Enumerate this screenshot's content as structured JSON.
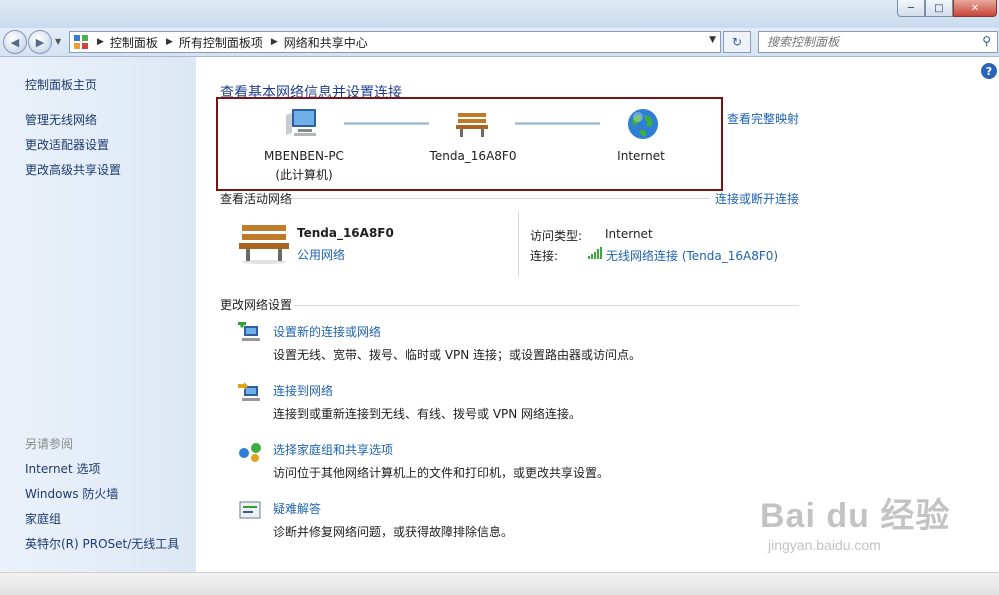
{
  "window": {
    "min": "─",
    "max": "□",
    "close": "✕"
  },
  "nav": {
    "back": "◀",
    "forward": "▶",
    "breadcrumb": [
      "控制面板",
      "所有控制面板项",
      "网络和共享中心"
    ],
    "search_placeholder": "搜索控制面板"
  },
  "sidebar": {
    "home": "控制面板主页",
    "links": [
      "管理无线网络",
      "更改适配器设置",
      "更改高级共享设置"
    ],
    "see_also_heading": "另请参阅",
    "see_also": [
      "Internet 选项",
      "Windows 防火墙",
      "家庭组",
      "英特尔(R) PROSet/无线工具"
    ]
  },
  "main": {
    "title": "查看基本网络信息并设置连接",
    "full_map": "查看完整映射",
    "map": {
      "computer_name": "MBENBEN-PC",
      "computer_sub": "(此计算机)",
      "router": "Tenda_16A8F0",
      "internet": "Internet"
    },
    "active": {
      "heading": "查看活动网络",
      "connect_link": "连接或断开连接",
      "name": "Tenda_16A8F0",
      "type": "公用网络",
      "access_label": "访问类型:",
      "access_value": "Internet",
      "conn_label": "连接:",
      "conn_value": "无线网络连接 (Tenda_16A8F0)"
    },
    "change": {
      "heading": "更改网络设置",
      "tasks": [
        {
          "link": "设置新的连接或网络",
          "desc": "设置无线、宽带、拨号、临时或 VPN 连接；或设置路由器或访问点。"
        },
        {
          "link": "连接到网络",
          "desc": "连接到或重新连接到无线、有线、拨号或 VPN 网络连接。"
        },
        {
          "link": "选择家庭组和共享选项",
          "desc": "访问位于其他网络计算机上的文件和打印机，或更改共享设置。"
        },
        {
          "link": "疑难解答",
          "desc": "诊断并修复网络问题，或获得故障排除信息。"
        }
      ]
    }
  },
  "watermark": {
    "brand": "Bai du 经验",
    "url": "jingyan.baidu.com"
  },
  "colors": {
    "link": "#1e63b0",
    "title": "#1e3d8f",
    "highlight_box": "#7a1414"
  }
}
